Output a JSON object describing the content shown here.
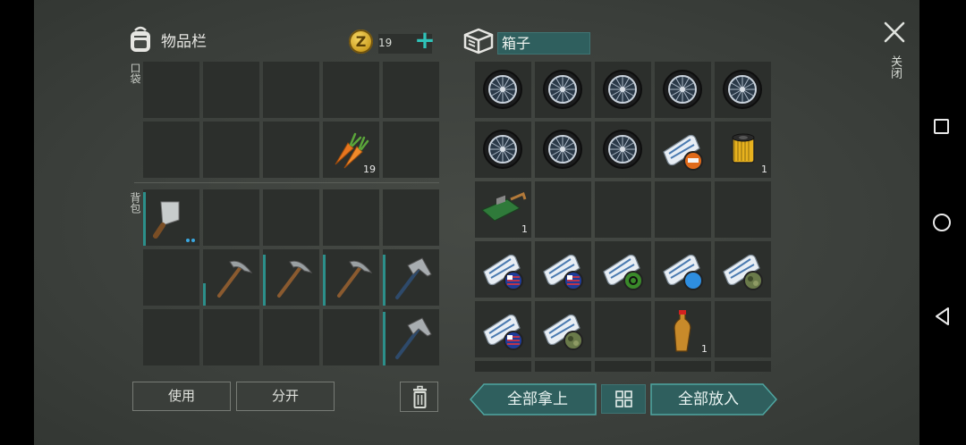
{
  "inventory": {
    "title": "物品栏",
    "icon": "backpack-icon",
    "coins": {
      "icon": "coin-icon",
      "symbol": "Z",
      "count": "19",
      "add_icon": "plus-icon"
    },
    "pocket_label": "口袋",
    "backpack_label": "背包",
    "pocket_slots": [
      {
        "item": null
      },
      {
        "item": null
      },
      {
        "item": null
      },
      {
        "item": null
      },
      {
        "item": null
      },
      {
        "item": null
      },
      {
        "item": null
      },
      {
        "item": null
      },
      {
        "item": "carrot",
        "count": "19"
      },
      {
        "item": null
      }
    ],
    "backpack_slots": [
      {
        "item": "cleaver",
        "durability": 0.95,
        "dots": 2
      },
      {
        "item": null
      },
      {
        "item": null
      },
      {
        "item": null
      },
      {
        "item": null
      },
      {
        "item": null
      },
      {
        "item": "pickaxe",
        "durability": 0.4
      },
      {
        "item": "pickaxe",
        "durability": 0.9
      },
      {
        "item": "pickaxe",
        "durability": 0.9
      },
      {
        "item": "hammer",
        "durability": 0.9
      },
      {
        "item": null
      },
      {
        "item": null
      },
      {
        "item": null
      },
      {
        "item": null
      },
      {
        "item": "hammer",
        "durability": 0.95
      }
    ],
    "use_button": "使用",
    "split_button": "分开",
    "trash_icon": "trash-icon"
  },
  "box": {
    "icon": "box-icon",
    "name": "箱子",
    "slots": [
      {
        "item": "wheel"
      },
      {
        "item": "wheel"
      },
      {
        "item": "wheel"
      },
      {
        "item": "wheel"
      },
      {
        "item": "wheel"
      },
      {
        "item": "wheel"
      },
      {
        "item": "wheel"
      },
      {
        "item": "wheel"
      },
      {
        "item": "blueprint-scroll",
        "badge": "orange"
      },
      {
        "item": "oil-filter",
        "count": "1"
      },
      {
        "item": "circuit-board",
        "count": "1"
      },
      {
        "item": null
      },
      {
        "item": null
      },
      {
        "item": null
      },
      {
        "item": null
      },
      {
        "item": "blueprint-scroll",
        "badge": "flag"
      },
      {
        "item": "blueprint-scroll",
        "badge": "flag"
      },
      {
        "item": "blueprint-scroll",
        "badge": "biohazard"
      },
      {
        "item": "blueprint-scroll",
        "badge": "blue"
      },
      {
        "item": "blueprint-scroll",
        "badge": "camo"
      },
      {
        "item": "blueprint-scroll",
        "badge": "flag"
      },
      {
        "item": "blueprint-scroll",
        "badge": "camo"
      },
      {
        "item": null
      },
      {
        "item": "bottle",
        "count": "1"
      },
      {
        "item": null
      }
    ],
    "take_all_button": "全部拿上",
    "put_all_button": "全部放入",
    "sort_icon": "grid-icon"
  },
  "close": {
    "icon": "close-icon",
    "label": "关闭"
  },
  "colors": {
    "accent": "#2c8f8a",
    "slot": "#2c2f2c",
    "button_teal": "#2f5f5e",
    "coin": "#e2b32d"
  },
  "navbar": {
    "recent_icon": "square-icon",
    "home_icon": "circle-icon",
    "back_icon": "triangle-back-icon"
  }
}
